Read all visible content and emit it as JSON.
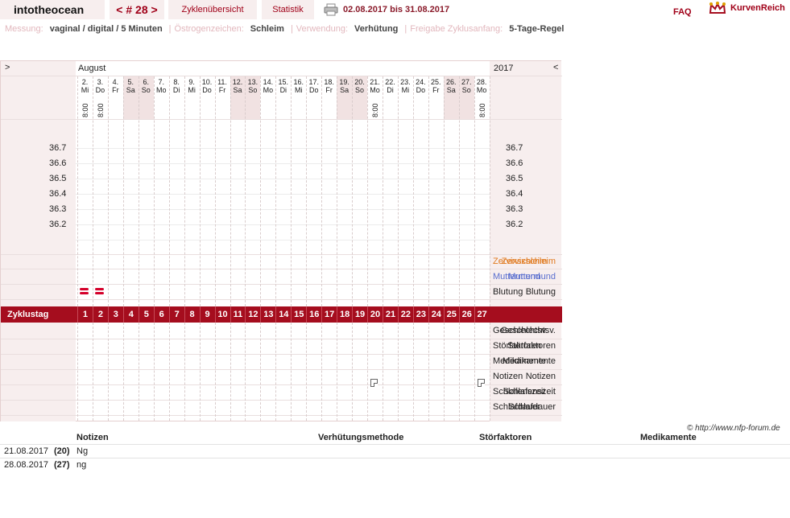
{
  "header": {
    "brand": "intotheocean",
    "cycle_prev": "<",
    "cycle_label": "# 28",
    "cycle_next": ">",
    "tab_overview": "Zyklenübersicht",
    "tab_stats": "Statistik",
    "date_range": "02.08.2017 bis 31.08.2017",
    "faq": "FAQ",
    "logo_text": "KurvenReich"
  },
  "info": {
    "measure_label": "Messung:",
    "measure_value": "vaginal / digital / 5 Minuten",
    "estrogen_label": "Östrogenzeichen:",
    "estrogen_value": "Schleim",
    "usage_label": "Verwendung:",
    "usage_value": "Verhütung",
    "release_label": "Freigabe Zyklusanfang:",
    "release_value": "5-Tage-Regel"
  },
  "chart": {
    "nav_left": ">",
    "nav_right": "<",
    "month": "August",
    "year": "2017",
    "days": [
      {
        "d": "2.",
        "w": "Mi",
        "t": "8:00",
        "we": false
      },
      {
        "d": "3.",
        "w": "Do",
        "t": "8:00",
        "we": false
      },
      {
        "d": "4.",
        "w": "Fr",
        "t": "",
        "we": false
      },
      {
        "d": "5.",
        "w": "Sa",
        "t": "",
        "we": true
      },
      {
        "d": "6.",
        "w": "So",
        "t": "",
        "we": true
      },
      {
        "d": "7.",
        "w": "Mo",
        "t": "",
        "we": false
      },
      {
        "d": "8.",
        "w": "Di",
        "t": "",
        "we": false
      },
      {
        "d": "9.",
        "w": "Mi",
        "t": "",
        "we": false
      },
      {
        "d": "10.",
        "w": "Do",
        "t": "",
        "we": false
      },
      {
        "d": "11.",
        "w": "Fr",
        "t": "",
        "we": false
      },
      {
        "d": "12.",
        "w": "Sa",
        "t": "",
        "we": true
      },
      {
        "d": "13.",
        "w": "So",
        "t": "",
        "we": true
      },
      {
        "d": "14.",
        "w": "Mo",
        "t": "",
        "we": false
      },
      {
        "d": "15.",
        "w": "Di",
        "t": "",
        "we": false
      },
      {
        "d": "16.",
        "w": "Mi",
        "t": "",
        "we": false
      },
      {
        "d": "17.",
        "w": "Do",
        "t": "",
        "we": false
      },
      {
        "d": "18.",
        "w": "Fr",
        "t": "",
        "we": false
      },
      {
        "d": "19.",
        "w": "Sa",
        "t": "",
        "we": true
      },
      {
        "d": "20.",
        "w": "So",
        "t": "",
        "we": true
      },
      {
        "d": "21.",
        "w": "Mo",
        "t": "8:00",
        "we": false
      },
      {
        "d": "22.",
        "w": "Di",
        "t": "",
        "we": false
      },
      {
        "d": "23.",
        "w": "Mi",
        "t": "",
        "we": false
      },
      {
        "d": "24.",
        "w": "Do",
        "t": "",
        "we": false
      },
      {
        "d": "25.",
        "w": "Fr",
        "t": "",
        "we": false
      },
      {
        "d": "26.",
        "w": "Sa",
        "t": "",
        "we": true
      },
      {
        "d": "27.",
        "w": "So",
        "t": "",
        "we": true
      },
      {
        "d": "28.",
        "w": "Mo",
        "t": "8:00",
        "we": false
      }
    ],
    "temps": [
      "36.7",
      "36.6",
      "36.5",
      "36.4",
      "36.3",
      "36.2"
    ],
    "rows_top": [
      "Zervixschleim",
      "Muttermund",
      "Blutung"
    ],
    "zyklustag_label": "Zyklustag",
    "cycle_days": [
      "1",
      "2",
      "3",
      "4",
      "5",
      "6",
      "7",
      "8",
      "9",
      "10",
      "11",
      "12",
      "13",
      "14",
      "15",
      "16",
      "17",
      "18",
      "19",
      "20",
      "21",
      "22",
      "23",
      "24",
      "25",
      "26",
      "27"
    ],
    "rows_bottom": [
      "Geschlechtsv.",
      "Störfaktoren",
      "Medikamente",
      "Notizen",
      "Schlafenszeit",
      "Schlafdauer"
    ],
    "bleeding_days": [
      1,
      2
    ],
    "note_days": [
      20,
      27
    ],
    "colors": {
      "zervix": "#e07a1f",
      "muttermund": "#5a6fcf",
      "accent": "#a50d1e"
    }
  },
  "copyright": "© http://www.nfp-forum.de",
  "notes": {
    "headers": [
      "Notizen",
      "Verhütungsmethode",
      "Störfaktoren",
      "Medikamente"
    ],
    "rows": [
      {
        "date": "21.08.2017",
        "day": "(20)",
        "note": "Ng"
      },
      {
        "date": "28.08.2017",
        "day": "(27)",
        "note": "ng"
      }
    ]
  }
}
